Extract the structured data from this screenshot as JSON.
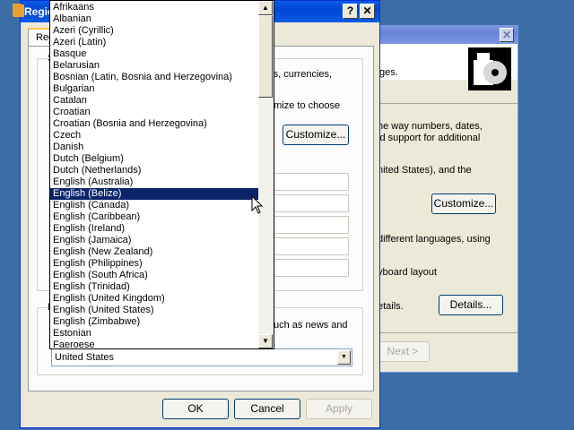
{
  "front_dialog": {
    "title": "Regio",
    "tab_label": "Reg",
    "group_label_1": "S",
    "group_label_2": "L",
    "right_text_1": "rs, currencies,",
    "right_text_2": "omize to choose",
    "customize_label": "Customize...",
    "right_text_3": "uch as news and",
    "location_value": "United States",
    "ok_label": "OK",
    "cancel_label": "Cancel",
    "apply_label": "Apply"
  },
  "back_dialog": {
    "header_text": "ges.",
    "text_1": "he way numbers, dates,",
    "text_2": "ld support for additional",
    "text_3": "nited States), and the",
    "customize_label": "Customize...",
    "text_4": "different languages, using",
    "text_5": "yboard layout",
    "text_6": "etails.",
    "details_label": "Details...",
    "next_label": "Next >"
  },
  "language_list": {
    "selected_index": 16,
    "items": [
      "Afrikaans",
      "Albanian",
      "Azeri (Cyrillic)",
      "Azeri (Latin)",
      "Basque",
      "Belarusian",
      "Bosnian (Latin, Bosnia and Herzegovina)",
      "Bulgarian",
      "Catalan",
      "Croatian",
      "Croatian (Bosnia and Herzegovina)",
      "Czech",
      "Danish",
      "Dutch (Belgium)",
      "Dutch (Netherlands)",
      "English (Australia)",
      "English (Belize)",
      "English (Canada)",
      "English (Caribbean)",
      "English (Ireland)",
      "English (Jamaica)",
      "English (New Zealand)",
      "English (Philippines)",
      "English (South Africa)",
      "English (Trinidad)",
      "English (United Kingdom)",
      "English (United States)",
      "English (Zimbabwe)",
      "Estonian",
      "Faeroese"
    ]
  },
  "colors": {
    "desktop": "#3a6ea5",
    "titlebar_active": "#0a5ce4",
    "selection": "#0a246a"
  }
}
